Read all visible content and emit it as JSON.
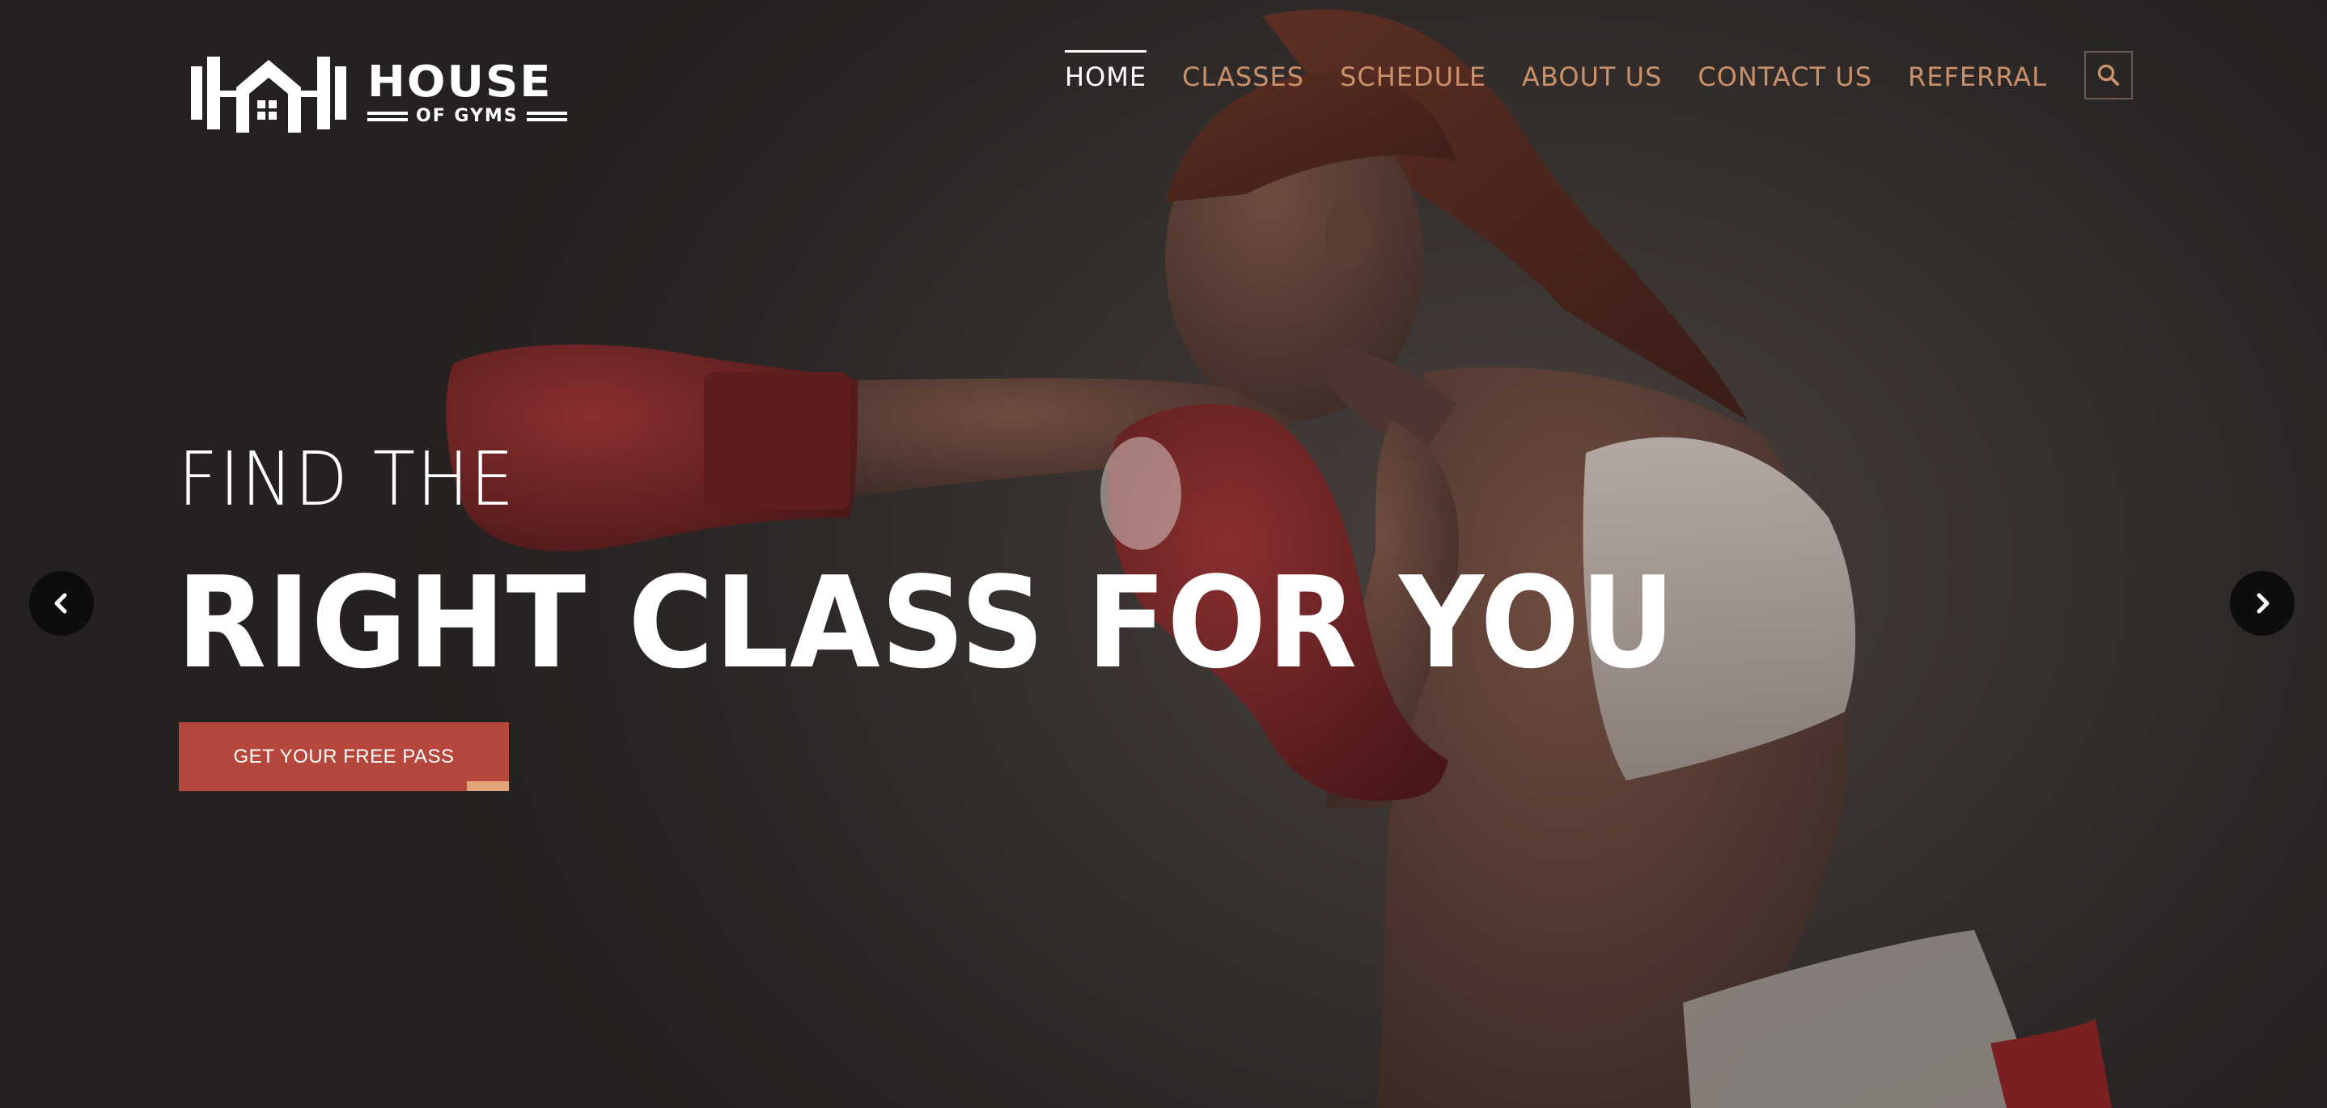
{
  "brand": {
    "name_line1": "HOUSE",
    "name_line2": "OF GYMS",
    "logo_icon": "barbell-house-icon"
  },
  "nav": {
    "items": [
      {
        "label": "HOME",
        "active": true
      },
      {
        "label": "CLASSES",
        "active": false
      },
      {
        "label": "SCHEDULE",
        "active": false
      },
      {
        "label": "ABOUT US",
        "active": false
      },
      {
        "label": "CONTACT US",
        "active": false
      },
      {
        "label": "REFERRAL",
        "active": false
      }
    ],
    "search_icon": "search-icon"
  },
  "hero": {
    "subtitle": "FIND THE",
    "title": "RIGHT CLASS FOR YOU",
    "cta_label": "GET YOUR FREE PASS",
    "prev_icon": "chevron-left-icon",
    "next_icon": "chevron-right-icon"
  },
  "colors": {
    "nav_link": "#c9906a",
    "nav_active": "#ffffff",
    "cta_bg": "#b6473c",
    "cta_accent": "#e0a679",
    "background": "#2a2625"
  }
}
